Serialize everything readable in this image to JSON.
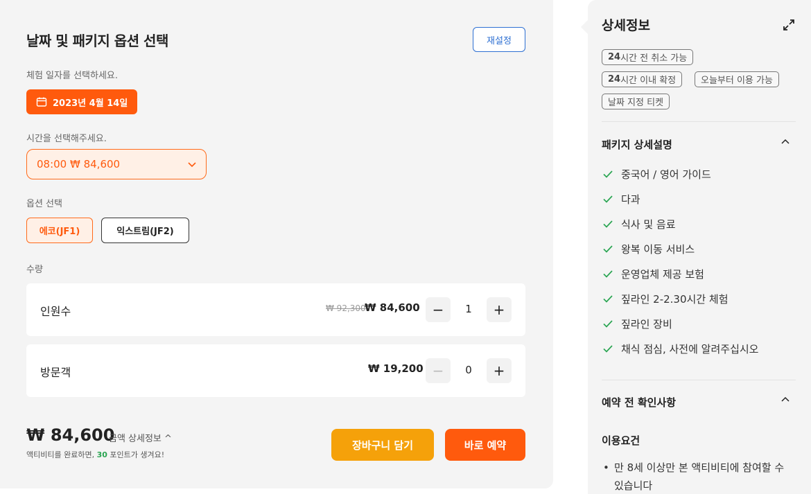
{
  "booking": {
    "title": "날짜 및 패키지 옵션 선택",
    "reset_label": "재설정",
    "date_label": "체험 일자를 선택하세요.",
    "date_value": "2023년 4월 14일",
    "time_label": "시간을 선택해주세요.",
    "time_value": "08:00 ₩ 84,600",
    "option_label": "옵션 선택",
    "options": [
      "에코(JF1)",
      "익스트림(JF2)"
    ],
    "selected_option": "에코(JF1)",
    "quantity_label": "수량",
    "quantities": [
      {
        "name": "인원수",
        "price_original": "₩ 92,300",
        "price": "₩ 84,600",
        "count": "1"
      },
      {
        "name": "방문객",
        "price": "₩ 19,200",
        "count": "0"
      }
    ],
    "total": "₩ 84,600",
    "total_detail": "금액 상세정보 ^",
    "points_prefix": "액티비티를 완료하면, ",
    "points_value": "30",
    "points_suffix": " 포인트가 생겨요!",
    "cart_label": "장바구니 담기",
    "book_label": "바로 예약"
  },
  "details": {
    "title": "상세정보",
    "tags": [
      {
        "bold": "24",
        "text": "시간 전 취소 가능"
      },
      {
        "bold": "24",
        "text": "시간 이내 확정"
      },
      {
        "bold": "",
        "text": "오늘부터 이용 가능"
      },
      {
        "bold": "",
        "text": "날짜 지정 티켓"
      }
    ],
    "package_title": "패키지 상세설명",
    "package_items": [
      "중국어 / 영어 가이드",
      "다과",
      "식사 및 음료",
      "왕복 이동 서비스",
      "운영업체 제공 보험",
      "짚라인 2-2.30시간 체험",
      "짚라인 장비",
      "채식 점심, 사전에 알려주십시오"
    ],
    "pre_booking_title": "예약 전 확인사항",
    "conditions_title": "이용요건",
    "conditions": [
      "만 8세 이상만 본 액티비티에 참여할 수 있습니다"
    ]
  },
  "colors": {
    "accent": "#ff5a0d",
    "cart": "#f5a10a",
    "link": "#2d6fd2",
    "check": "#2aa552"
  },
  "icons": {
    "date": "calendar-icon",
    "time": "chevron-down-icon",
    "expand": "expand-icon",
    "check": "check-icon",
    "collapse": "chevron-up-icon"
  }
}
